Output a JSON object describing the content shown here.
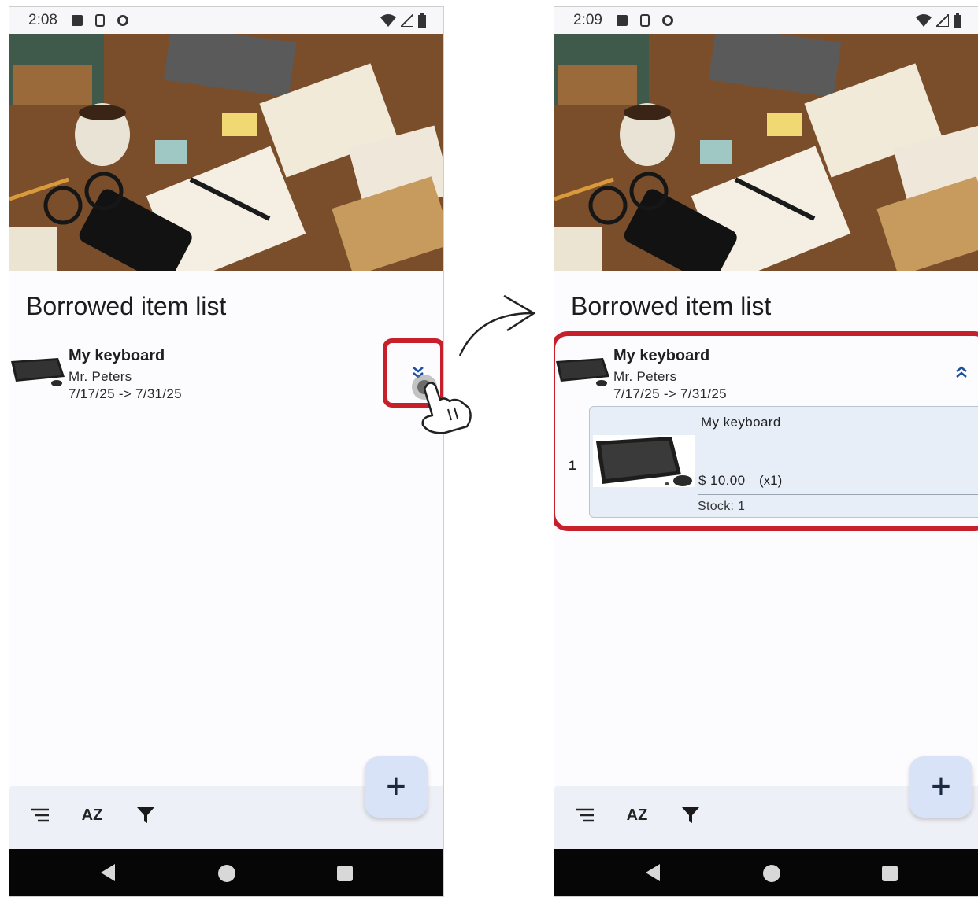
{
  "screens": [
    {
      "id": "before",
      "status_bar": {
        "time": "2:08"
      },
      "page_title": "Borrowed item list",
      "items": [
        {
          "title": "My keyboard",
          "owner": "Mr. Peters",
          "dates": "7/17/25 -> 7/31/25",
          "expanded": false
        }
      ],
      "toolbar": {
        "sort_icon": "sort-lines-icon",
        "az_label": "AZ",
        "filter_icon": "filter-icon"
      },
      "fab": {
        "label": "+"
      }
    },
    {
      "id": "after",
      "status_bar": {
        "time": "2:09"
      },
      "page_title": "Borrowed item list",
      "items": [
        {
          "title": "My keyboard",
          "owner": "Mr. Peters",
          "dates": "7/17/25 -> 7/31/25",
          "expanded": true,
          "detail": {
            "index": "1",
            "name": "My keyboard",
            "price": "$ 10.00",
            "quantity": "(x1)",
            "stock": "Stock: 1"
          }
        }
      ],
      "toolbar": {
        "sort_icon": "sort-lines-icon",
        "az_label": "AZ",
        "filter_icon": "filter-icon"
      },
      "fab": {
        "label": "+"
      }
    }
  ],
  "colors": {
    "highlight": "#c8202b",
    "accent": "#1a4fa0",
    "card_bg": "#e8eef8",
    "fab_bg": "#d9e3f7"
  }
}
